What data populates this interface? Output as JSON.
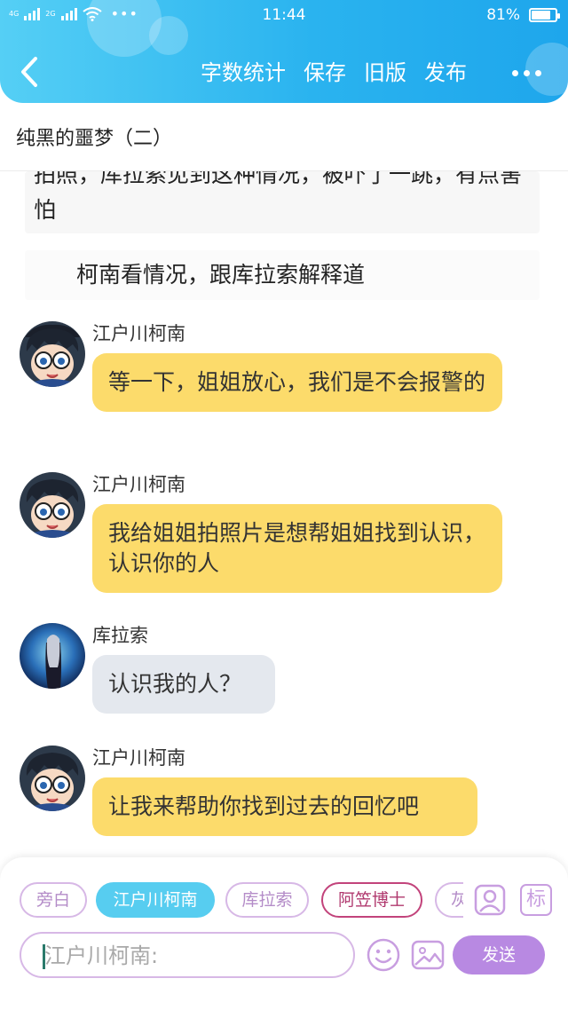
{
  "status_bar": {
    "network_1": "4G",
    "network_2": "2G",
    "dots": "•••",
    "time": "11:44",
    "battery_text": "81%",
    "battery_level": 0.81
  },
  "toolbar": {
    "word_count": "字数统计",
    "save": "保存",
    "old_version": "旧版",
    "publish": "发布"
  },
  "chapter_title": "纯黑的噩梦（二）",
  "narration": [
    "拍照，库拉索见到这种情况，被吓了一跳，有点害怕",
    "柯南看情况，跟库拉索解释道"
  ],
  "messages": [
    {
      "sender": "江户川柯南",
      "text": "等一下，姐姐放心，我们是不会报警的",
      "style": "yellow",
      "avatar": "conan-avatar"
    },
    {
      "sender": "江户川柯南",
      "text": "我给姐姐拍照片是想帮姐姐找到认识，认识你的人",
      "style": "yellow",
      "avatar": "conan-avatar"
    },
    {
      "sender": "库拉索",
      "text": "认识我的人？",
      "style": "gray",
      "avatar": "curacao-avatar"
    },
    {
      "sender": "江户川柯南",
      "text": "让我来帮助你找到过去的回忆吧",
      "style": "yellow",
      "avatar": "conan-avatar"
    }
  ],
  "role_chips": [
    {
      "label": "旁白",
      "active": false
    },
    {
      "label": "江户川柯南",
      "active": true
    },
    {
      "label": "库拉索",
      "active": false
    },
    {
      "label": "阿笠博士",
      "active": false
    },
    {
      "label": "灰",
      "active": false
    }
  ],
  "mark_button_label": "标",
  "input": {
    "placeholder": "江户川柯南:"
  },
  "send_button": "发送",
  "colors": {
    "header_start": "#55cff5",
    "header_end": "#1ea6ec",
    "bubble_yellow": "#fcdb6b",
    "bubble_gray": "#e4e8ee",
    "chip_active": "#57cdf0",
    "send": "#b889e2"
  },
  "icons": [
    "back-arrow-icon",
    "more-dots-icon",
    "character-card-icon",
    "emoji-icon",
    "image-icon"
  ]
}
